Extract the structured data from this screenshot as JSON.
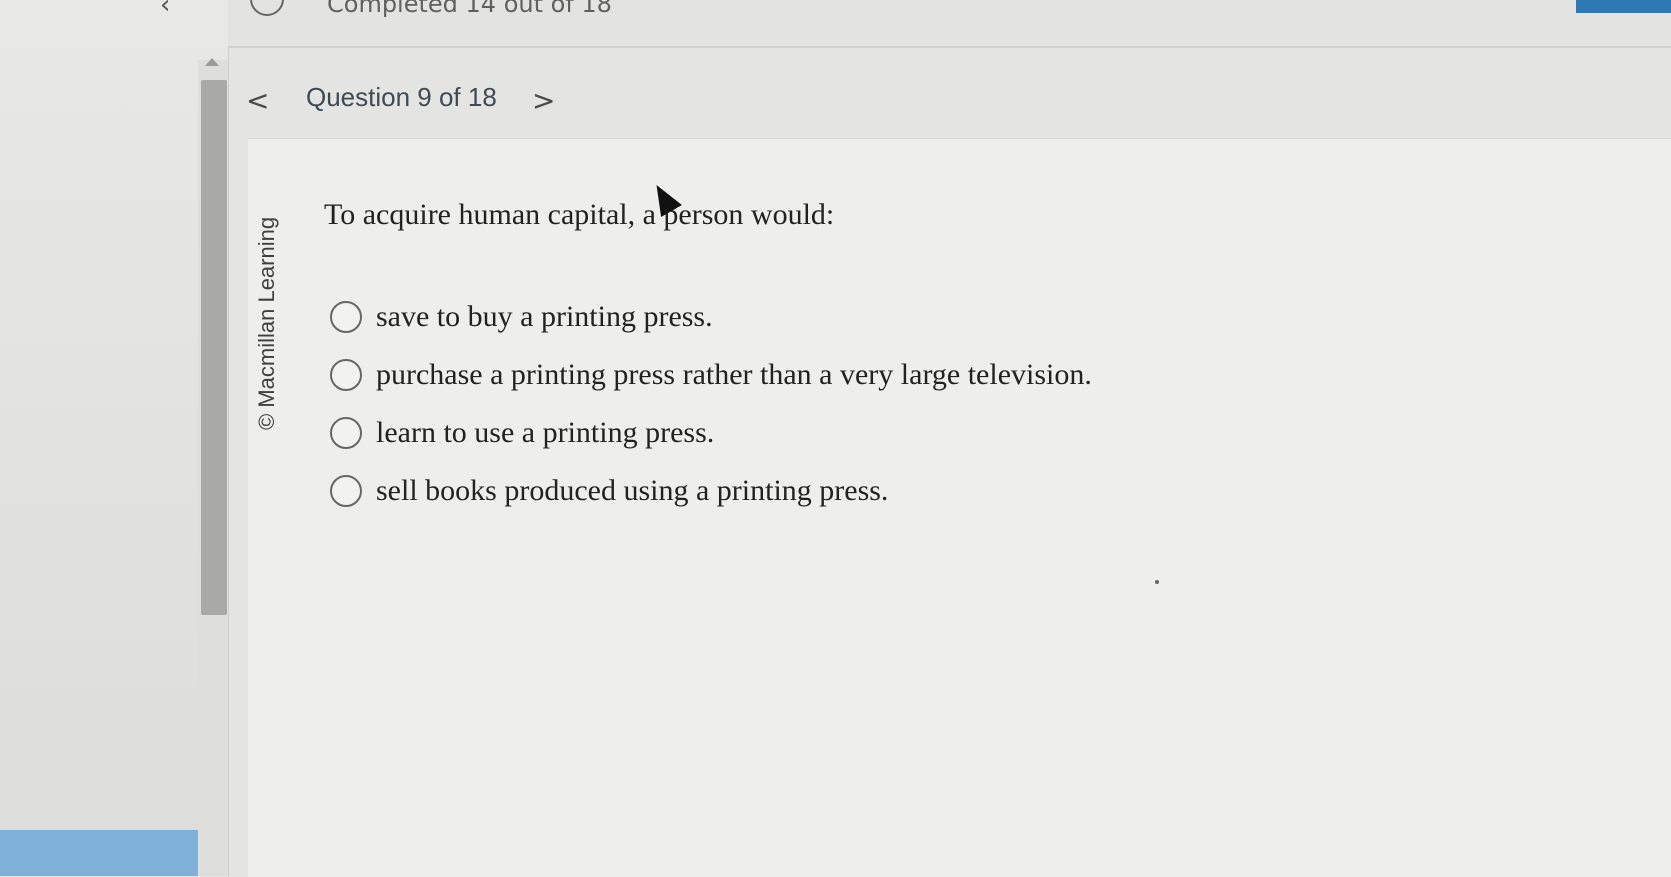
{
  "header": {
    "back_glyph": "‹",
    "info_icon": "info-icon",
    "status": "Completed 14 out of 18"
  },
  "question_nav": {
    "prev_glyph": "<",
    "title": "Question 9 of 18",
    "next_glyph": ">"
  },
  "question": {
    "copyright": "© Macmillan Learning",
    "stem": "To acquire human capital, a person would:",
    "options": [
      "save to buy a printing press.",
      "purchase a printing press rather than a very large television.",
      "learn to use a printing press.",
      "sell books produced using a printing press."
    ]
  },
  "colors": {
    "accent_blue": "#2e79b4",
    "panel_blue": "#7fb0d8",
    "background": "#e4e4e2",
    "card": "#eeeeec"
  }
}
